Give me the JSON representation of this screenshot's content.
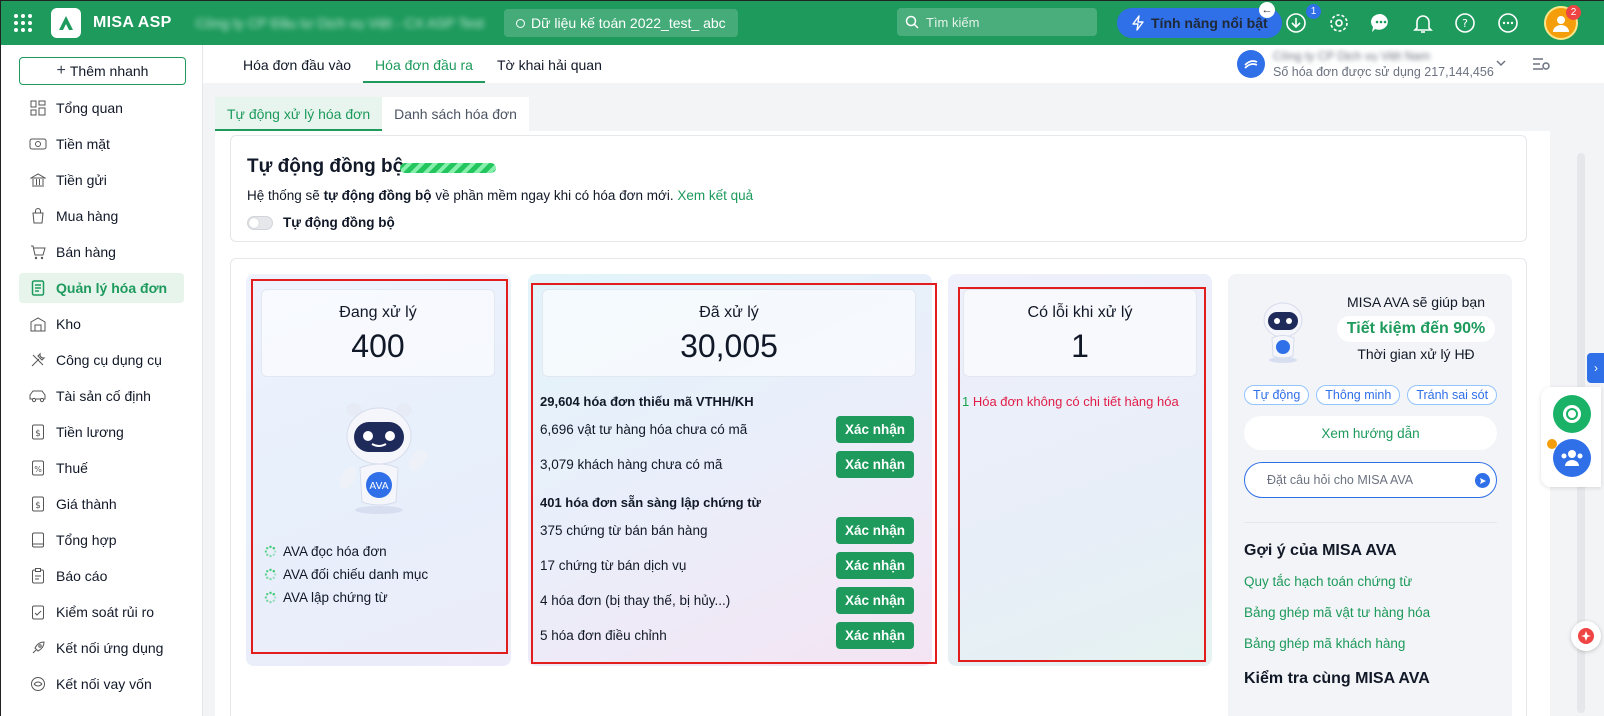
{
  "topbar": {
    "app_name": "MISA ASP",
    "company_name": "Công ty CP Đầu tư Dịch vụ Việt - CX ASP Test",
    "database": "Dữ liệu kế toán 2022_test_ abc",
    "search_placeholder": "Tìm kiếm",
    "feature_button": "Tính năng nổi bật",
    "download_badge": "1",
    "avatar_badge": "2"
  },
  "sidebar": {
    "quick_add": "Thêm nhanh",
    "items": [
      {
        "label": "Tổng quan",
        "icon": "dashboard-icon"
      },
      {
        "label": "Tiền mặt",
        "icon": "cash-icon"
      },
      {
        "label": "Tiền gửi",
        "icon": "bank-icon"
      },
      {
        "label": "Mua hàng",
        "icon": "shopping-bag-icon"
      },
      {
        "label": "Bán hàng",
        "icon": "cart-icon"
      },
      {
        "label": "Quản lý hóa đơn",
        "icon": "invoice-icon"
      },
      {
        "label": "Kho",
        "icon": "warehouse-icon"
      },
      {
        "label": "Công cụ dụng cụ",
        "icon": "tools-icon"
      },
      {
        "label": "Tài sản cố định",
        "icon": "vehicle-icon"
      },
      {
        "label": "Tiền lương",
        "icon": "payroll-icon"
      },
      {
        "label": "Thuế",
        "icon": "tax-icon"
      },
      {
        "label": "Giá thành",
        "icon": "cost-icon"
      },
      {
        "label": "Tổng hợp",
        "icon": "book-icon"
      },
      {
        "label": "Báo cáo",
        "icon": "report-icon"
      },
      {
        "label": "Kiểm soát rủi ro",
        "icon": "risk-icon"
      },
      {
        "label": "Kết nối ứng dụng",
        "icon": "rocket-icon"
      },
      {
        "label": "Kết nối vay vốn",
        "icon": "loan-icon"
      }
    ],
    "active_index": 5
  },
  "main": {
    "tabs": [
      {
        "label": "Hóa đơn đầu vào"
      },
      {
        "label": "Hóa đơn đầu ra"
      },
      {
        "label": "Tờ khai hải quan"
      }
    ],
    "quota": {
      "name": "Công ty CP Dịch vụ Việt Nam",
      "text": "Số hóa đơn được sử dụng 217,144,456"
    },
    "subtabs": [
      {
        "label": "Tự động xử lý hóa đơn"
      },
      {
        "label": "Danh sách hóa đơn"
      }
    ]
  },
  "sync": {
    "title": "Tự động đồng bộ",
    "desc_before": "Hệ thống sẽ ",
    "desc_bold": "tự động đồng bộ",
    "desc_after": " về phần mềm ngay khi có hóa đơn mới. ",
    "desc_link": "Xem kết quả",
    "toggle_label": "Tự động đồng bộ",
    "toggle_on": false
  },
  "processing": {
    "label": "Đang xử lý",
    "value": "400",
    "steps": [
      "AVA đọc hóa đơn",
      "AVA đối chiếu danh mục",
      "AVA lập chứng từ"
    ]
  },
  "processed": {
    "label": "Đã xử lý",
    "value": "30,005",
    "group1_title": "29,604 hóa đơn thiếu mã VTHH/KH",
    "group1_rows": [
      "6,696 vật tư hàng hóa chưa có mã",
      "3,079 khách hàng chưa có mã"
    ],
    "group2_title": "401 hóa đơn sẵn sàng lập chứng từ",
    "group2_rows": [
      "375 chứng từ bán bán hàng",
      "17 chứng từ bán dịch vụ",
      "4 hóa đơn (bị thay thế, bị hủy...)",
      "5 hóa đơn điều chỉnh"
    ],
    "confirm_label": "Xác nhận"
  },
  "errors": {
    "label": "Có lỗi khi xử lý",
    "value": "1",
    "line_number": "1",
    "line_text": " Hóa đơn không có chi tiết hàng hóa"
  },
  "ava": {
    "line1": "MISA AVA sẽ giúp bạn",
    "highlight": "Tiết kiệm đến 90%",
    "line2": "Thời gian xử lý HĐ",
    "chips": [
      "Tự động",
      "Thông minh",
      "Tránh sai sót"
    ],
    "guide_button": "Xem hướng dẫn",
    "ask_placeholder": "Đặt câu hỏi cho MISA AVA",
    "suggest_title": "Gợi ý của MISA AVA",
    "suggest_links": [
      "Quy tắc hạch toán chứng từ",
      "Bảng ghép mã vật tư hàng hóa",
      "Bảng ghép mã khách hàng"
    ],
    "check_title": "Kiểm tra cùng MISA AVA"
  },
  "colors": {
    "brand_green": "#1d9a5c",
    "accent_blue": "#2f6fe8",
    "highlight_red": "#e11d1d"
  }
}
